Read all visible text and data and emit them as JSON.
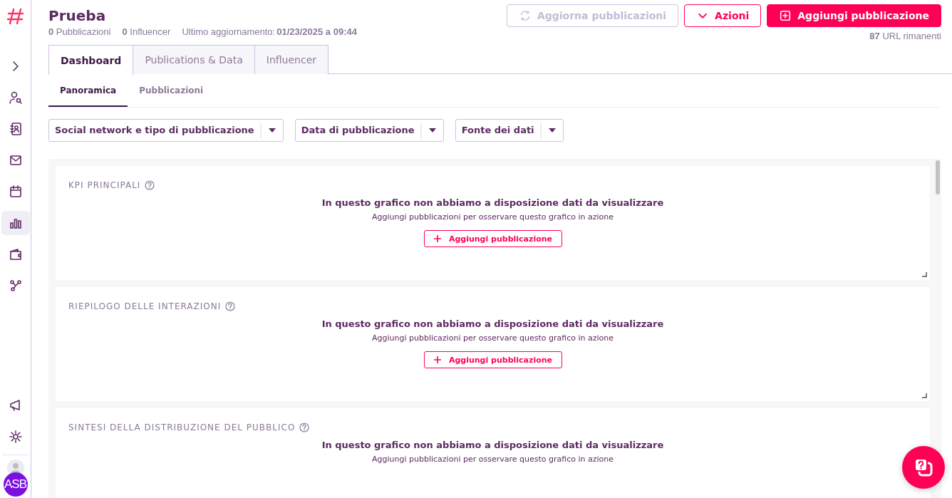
{
  "sidebar": {
    "items": [
      {
        "selected": false
      },
      {
        "selected": false
      },
      {
        "selected": false
      },
      {
        "selected": false
      },
      {
        "selected": false
      },
      {
        "selected": true
      },
      {
        "selected": false
      },
      {
        "selected": false
      }
    ],
    "bottom_items": [
      {
        "selected": false
      },
      {
        "selected": false
      }
    ],
    "avatar": "ASB"
  },
  "header": {
    "title": "Prueba",
    "stats": [
      "**0** Pubblicazioni",
      "**0** Influencer"
    ],
    "last_update": {
      "label": "Ultimo aggiornamento:",
      "value": "01/23/2025 a 09:44"
    },
    "buttons": [
      {
        "label": "Aggiorna pubblicazioni",
        "kind": "refresh",
        "disabled": true
      },
      {
        "label": "Azioni",
        "kind": "dropdown",
        "disabled": false
      },
      {
        "label": "Aggiungi pubblicazione",
        "kind": "add",
        "disabled": false
      }
    ],
    "quota": {
      "value": "87",
      "label": "URL rimanenti"
    }
  },
  "tabs": [
    {
      "label": "Dashboard",
      "selected": true
    },
    {
      "label": "Publications & Data",
      "selected": false
    },
    {
      "label": "Influencer",
      "selected": false
    }
  ],
  "subtabs": [
    {
      "label": "Panoramica",
      "selected": true
    },
    {
      "label": "Pubblicazioni",
      "selected": false
    }
  ],
  "filters": [
    "Social network e tipo di pubblicazione",
    "Data di pubblicazione",
    "Fonte dei dati"
  ],
  "cards": [
    {
      "title": "KPI PRINCIPALI",
      "message": "In questo grafico non abbiamo a disposizione dati da visualizzare",
      "hint": "Aggiungi pubblicazioni per osservare questo grafico in azione",
      "button": "Aggiungi pubblicazione"
    },
    {
      "title": "RIEPILOGO DELLE INTERAZIONI",
      "message": "In questo grafico non abbiamo a disposizione dati da visualizzare",
      "hint": "Aggiungi pubblicazioni per osservare questo grafico in azione",
      "button": "Aggiungi pubblicazione"
    },
    {
      "title": "SINTESI DELLA DISTRIBUZIONE DEL PUBBLICO",
      "message": "In questo grafico non abbiamo a disposizione dati da visualizzare",
      "hint": "Aggiungi pubblicazioni per osservare questo grafico in azione"
    }
  ]
}
